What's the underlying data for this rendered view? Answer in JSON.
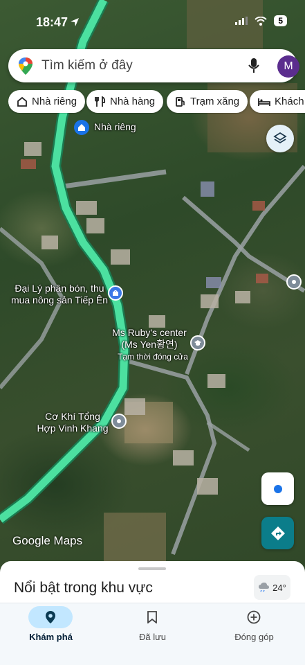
{
  "status_bar": {
    "time": "18:47",
    "battery": "5"
  },
  "search": {
    "placeholder": "Tìm kiếm ở đây",
    "avatar_letter": "M"
  },
  "chips": [
    {
      "label": "Nhà riêng",
      "icon": "home-icon"
    },
    {
      "label": "Nhà hàng",
      "icon": "restaurant-icon"
    },
    {
      "label": "Trạm xăng",
      "icon": "gas-station-icon"
    },
    {
      "label": "Khách sạn",
      "icon": "hotel-icon"
    }
  ],
  "map": {
    "home_label": "Nhà riêng",
    "poi_1": {
      "line1": "Đại Lý phân bón, thu",
      "line2": "mua nông sản Tiếp Ên"
    },
    "poi_2": {
      "line1": "Ms Ruby's center",
      "line2": "(Ms Yen황연)",
      "status": "Tạm thời đóng cửa"
    },
    "poi_3": {
      "line1": "Cơ Khí Tổng",
      "line2": "Hợp Vinh Khang"
    },
    "logo": "Google Maps",
    "road_color": "#4ce0a0"
  },
  "sheet": {
    "title": "Nổi bật trong khu vực",
    "temperature": "24°"
  },
  "tabs": [
    {
      "label": "Khám phá",
      "icon": "explore-pin-icon",
      "active": true
    },
    {
      "label": "Đã lưu",
      "icon": "bookmark-icon",
      "active": false
    },
    {
      "label": "Đóng góp",
      "icon": "add-circle-icon",
      "active": false
    }
  ]
}
